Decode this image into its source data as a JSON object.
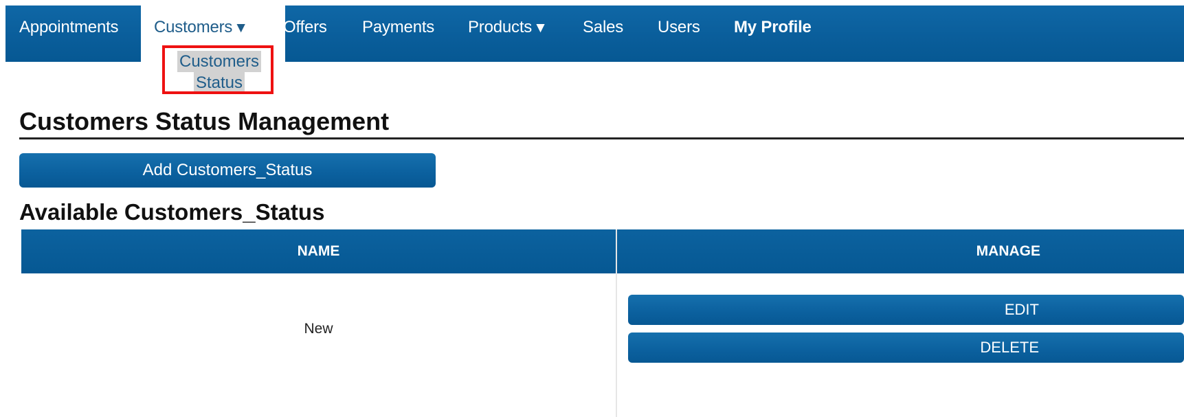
{
  "nav": {
    "items": [
      {
        "label": "Appointments"
      },
      {
        "label": "Customers",
        "caret": "▼"
      },
      {
        "label": "Offers"
      },
      {
        "label": "Payments"
      },
      {
        "label": "Products",
        "caret": "▼"
      },
      {
        "label": "Sales"
      },
      {
        "label": "Users"
      },
      {
        "label": "My Profile"
      }
    ],
    "customers_dropdown": {
      "item_line1": "Customers",
      "item_line2": "Status"
    }
  },
  "page": {
    "title": "Customers Status Management",
    "add_button": "Add Customers_Status",
    "section_title": "Available Customers_Status"
  },
  "table": {
    "headers": {
      "name": "NAME",
      "manage": "MANAGE"
    },
    "rows": [
      {
        "name": "New",
        "edit_label": "EDIT",
        "delete_label": "DELETE"
      }
    ]
  },
  "colors": {
    "nav_blue": "#0a5e9b",
    "button_blue": "#0b609e",
    "highlight_red": "#ee1111",
    "dropdown_bg": "#d2d2d2"
  }
}
